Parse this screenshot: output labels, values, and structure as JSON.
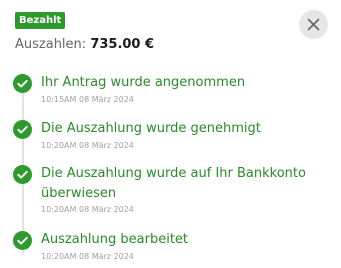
{
  "header": {
    "status_badge": "Bezahlt",
    "amount_label": "Auszahlen:",
    "amount_value": "735.00 €",
    "close_icon": "close-icon"
  },
  "colors": {
    "success": "#2e9a2e",
    "title_green": "#2a8a2a",
    "close_bg": "#e6e6e6"
  },
  "timeline": {
    "steps": [
      {
        "icon": "check-circle-icon",
        "title": "Ihr Antrag wurde angenommen",
        "time": "10:15AM 08 März 2024"
      },
      {
        "icon": "check-circle-icon",
        "title": "Die Auszahlung wurde genehmigt",
        "time": "10:20AM 08 März 2024"
      },
      {
        "icon": "check-circle-icon",
        "title": "Die Auszahlung wurde auf Ihr Bankkonto überwiesen",
        "time": "10:20AM 08 März 2024"
      },
      {
        "icon": "check-circle-icon",
        "title": "Auszahlung bearbeitet",
        "time": "10:20AM 08 März 2024"
      }
    ]
  }
}
